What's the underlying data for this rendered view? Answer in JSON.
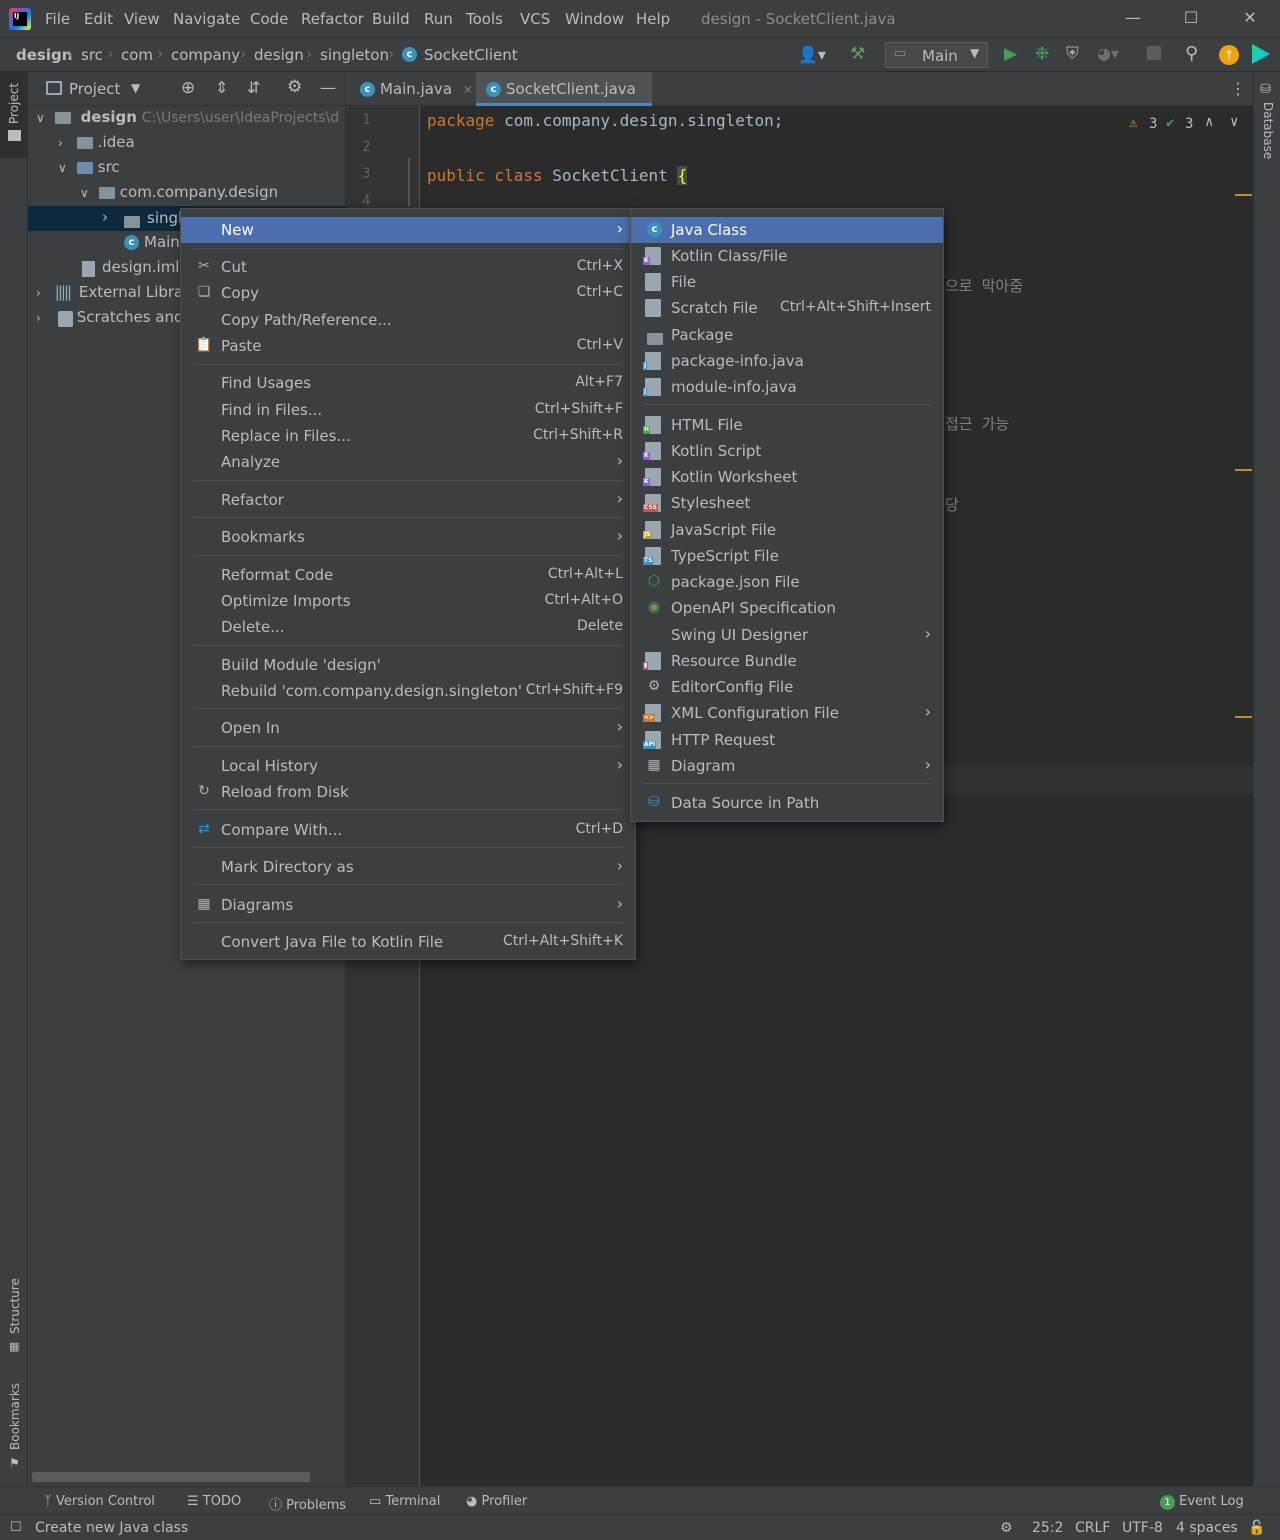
{
  "window": {
    "title": "design - SocketClient.java",
    "menu": [
      "File",
      "Edit",
      "View",
      "Navigate",
      "Code",
      "Refactor",
      "Build",
      "Run",
      "Tools",
      "VCS",
      "Window",
      "Help"
    ]
  },
  "breadcrumb": [
    "design",
    "src",
    "com",
    "company",
    "design",
    "singleton",
    "SocketClient"
  ],
  "toolbar": {
    "run_config": "Main"
  },
  "side_strips": {
    "left_top": "Project",
    "left_mid": "Structure",
    "left_bottom": "Bookmarks",
    "right": "Database"
  },
  "project_panel": {
    "title": "Project",
    "tree": [
      {
        "label": "design",
        "extra": "C:\\Users\\user\\IdeaProjects\\d"
      },
      {
        "label": ".idea"
      },
      {
        "label": "src"
      },
      {
        "label": "com.company.design"
      },
      {
        "label": "singl"
      },
      {
        "label": "Main"
      },
      {
        "label": "design.iml"
      },
      {
        "label": "External Librari"
      },
      {
        "label": "Scratches and"
      }
    ]
  },
  "editor": {
    "tabs": [
      {
        "label": "Main.java"
      },
      {
        "label": "SocketClient.java"
      }
    ],
    "line_numbers": [
      "1",
      "2",
      "3",
      "4"
    ],
    "code": {
      "line1_kw": "package",
      "line1_rest": " com.company.design.singleton;",
      "line3_kw": "public class",
      "line3_rest": " SocketClient ",
      "line3_brace": "{"
    },
    "korean_fragments": [
      "으로 막아줌",
      "접근 가능",
      "당"
    ],
    "inspections": {
      "warnings": "3",
      "ok": "3"
    }
  },
  "context_menu": {
    "items": [
      {
        "label": "New",
        "shortcut": ""
      },
      {
        "label": "Cut",
        "shortcut": "Ctrl+X"
      },
      {
        "label": "Copy",
        "shortcut": "Ctrl+C"
      },
      {
        "label": "Copy Path/Reference...",
        "shortcut": ""
      },
      {
        "label": "Paste",
        "shortcut": "Ctrl+V"
      },
      {
        "label": "Find Usages",
        "shortcut": "Alt+F7"
      },
      {
        "label": "Find in Files...",
        "shortcut": "Ctrl+Shift+F"
      },
      {
        "label": "Replace in Files...",
        "shortcut": "Ctrl+Shift+R"
      },
      {
        "label": "Analyze",
        "shortcut": ""
      },
      {
        "label": "Refactor",
        "shortcut": ""
      },
      {
        "label": "Bookmarks",
        "shortcut": ""
      },
      {
        "label": "Reformat Code",
        "shortcut": "Ctrl+Alt+L"
      },
      {
        "label": "Optimize Imports",
        "shortcut": "Ctrl+Alt+O"
      },
      {
        "label": "Delete...",
        "shortcut": "Delete"
      },
      {
        "label": "Build Module 'design'",
        "shortcut": ""
      },
      {
        "label": "Rebuild 'com.company.design.singleton'",
        "shortcut": "Ctrl+Shift+F9"
      },
      {
        "label": "Open In",
        "shortcut": ""
      },
      {
        "label": "Local History",
        "shortcut": ""
      },
      {
        "label": "Reload from Disk",
        "shortcut": ""
      },
      {
        "label": "Compare With...",
        "shortcut": "Ctrl+D"
      },
      {
        "label": "Mark Directory as",
        "shortcut": ""
      },
      {
        "label": "Diagrams",
        "shortcut": ""
      },
      {
        "label": "Convert Java File to Kotlin File",
        "shortcut": "Ctrl+Alt+Shift+K"
      }
    ]
  },
  "new_submenu": {
    "items": [
      {
        "label": "Java Class",
        "shortcut": ""
      },
      {
        "label": "Kotlin Class/File",
        "shortcut": ""
      },
      {
        "label": "File",
        "shortcut": ""
      },
      {
        "label": "Scratch File",
        "shortcut": "Ctrl+Alt+Shift+Insert"
      },
      {
        "label": "Package",
        "shortcut": ""
      },
      {
        "label": "package-info.java",
        "shortcut": ""
      },
      {
        "label": "module-info.java",
        "shortcut": ""
      },
      {
        "label": "HTML File",
        "shortcut": ""
      },
      {
        "label": "Kotlin Script",
        "shortcut": ""
      },
      {
        "label": "Kotlin Worksheet",
        "shortcut": ""
      },
      {
        "label": "Stylesheet",
        "shortcut": ""
      },
      {
        "label": "JavaScript File",
        "shortcut": ""
      },
      {
        "label": "TypeScript File",
        "shortcut": ""
      },
      {
        "label": "package.json File",
        "shortcut": ""
      },
      {
        "label": "OpenAPI Specification",
        "shortcut": ""
      },
      {
        "label": "Swing UI Designer",
        "shortcut": ""
      },
      {
        "label": "Resource Bundle",
        "shortcut": ""
      },
      {
        "label": "EditorConfig File",
        "shortcut": ""
      },
      {
        "label": "XML Configuration File",
        "shortcut": ""
      },
      {
        "label": "HTTP Request",
        "shortcut": ""
      },
      {
        "label": "Diagram",
        "shortcut": ""
      },
      {
        "label": "Data Source in Path",
        "shortcut": ""
      }
    ]
  },
  "bottom_tools": [
    "Version Control",
    "TODO",
    "Problems",
    "Terminal",
    "Profiler",
    "Event Log"
  ],
  "event_log_count": "1",
  "status": {
    "message": "Create new Java class",
    "position": "25:2",
    "line_sep": "CRLF",
    "encoding": "UTF-8",
    "indent": "4 spaces"
  },
  "colors": {
    "selection": "#4b6eaf",
    "keyword": "#cc7832",
    "panel": "#3c3f41",
    "editor": "#2b2b2b"
  }
}
